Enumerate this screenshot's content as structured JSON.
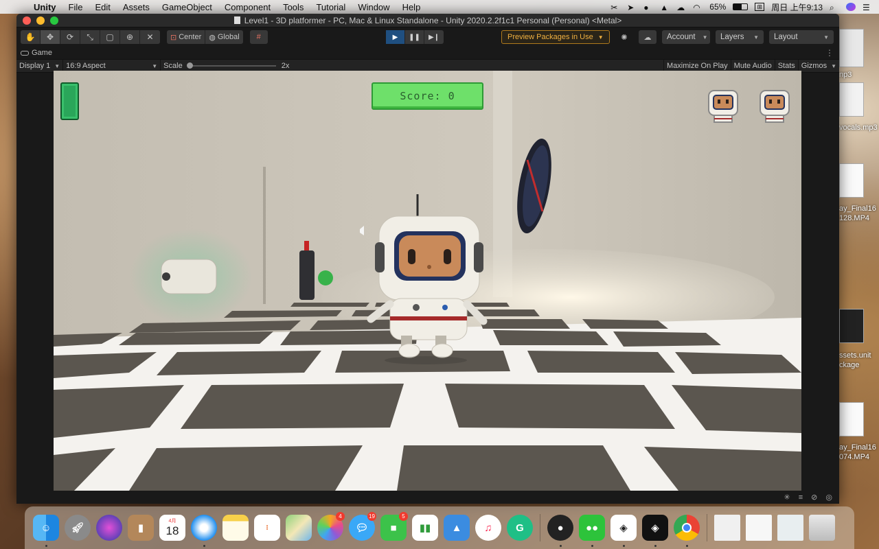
{
  "menubar": {
    "app_name": "Unity",
    "items": [
      "File",
      "Edit",
      "Assets",
      "GameObject",
      "Component",
      "Tools",
      "Tutorial",
      "Window",
      "Help"
    ],
    "battery": "65%",
    "clock": "周日 上午9:13"
  },
  "window": {
    "title": "Level1 - 3D platformer - PC, Mac & Linux Standalone - Unity 2020.2.2f1c1 Personal (Personal) <Metal>"
  },
  "toolbar": {
    "pivot_center": "Center",
    "pivot_global": "Global",
    "preview_packages": "Preview Packages in Use",
    "account": "Account",
    "layers": "Layers",
    "layout": "Layout"
  },
  "game_tab": {
    "label": "Game",
    "display": "Display 1",
    "aspect": "16:9 Aspect",
    "scale_label": "Scale",
    "scale_value": "2x",
    "maximize": "Maximize On Play",
    "mute": "Mute Audio",
    "stats": "Stats",
    "gizmos": "Gizmos"
  },
  "game_hud": {
    "score_text": "Score: 0",
    "lives": 2
  },
  "desktop_files": [
    "np3",
    "vocals.mp3",
    "ay_Final16",
    "128.MP4",
    "ssets.unit",
    "ckage",
    "ay_Final16",
    "074.MP4"
  ],
  "dock": {
    "calendar_month": "4月",
    "calendar_day": "18",
    "badges": {
      "photos": "4",
      "messages": "19",
      "facetime": "5"
    }
  }
}
